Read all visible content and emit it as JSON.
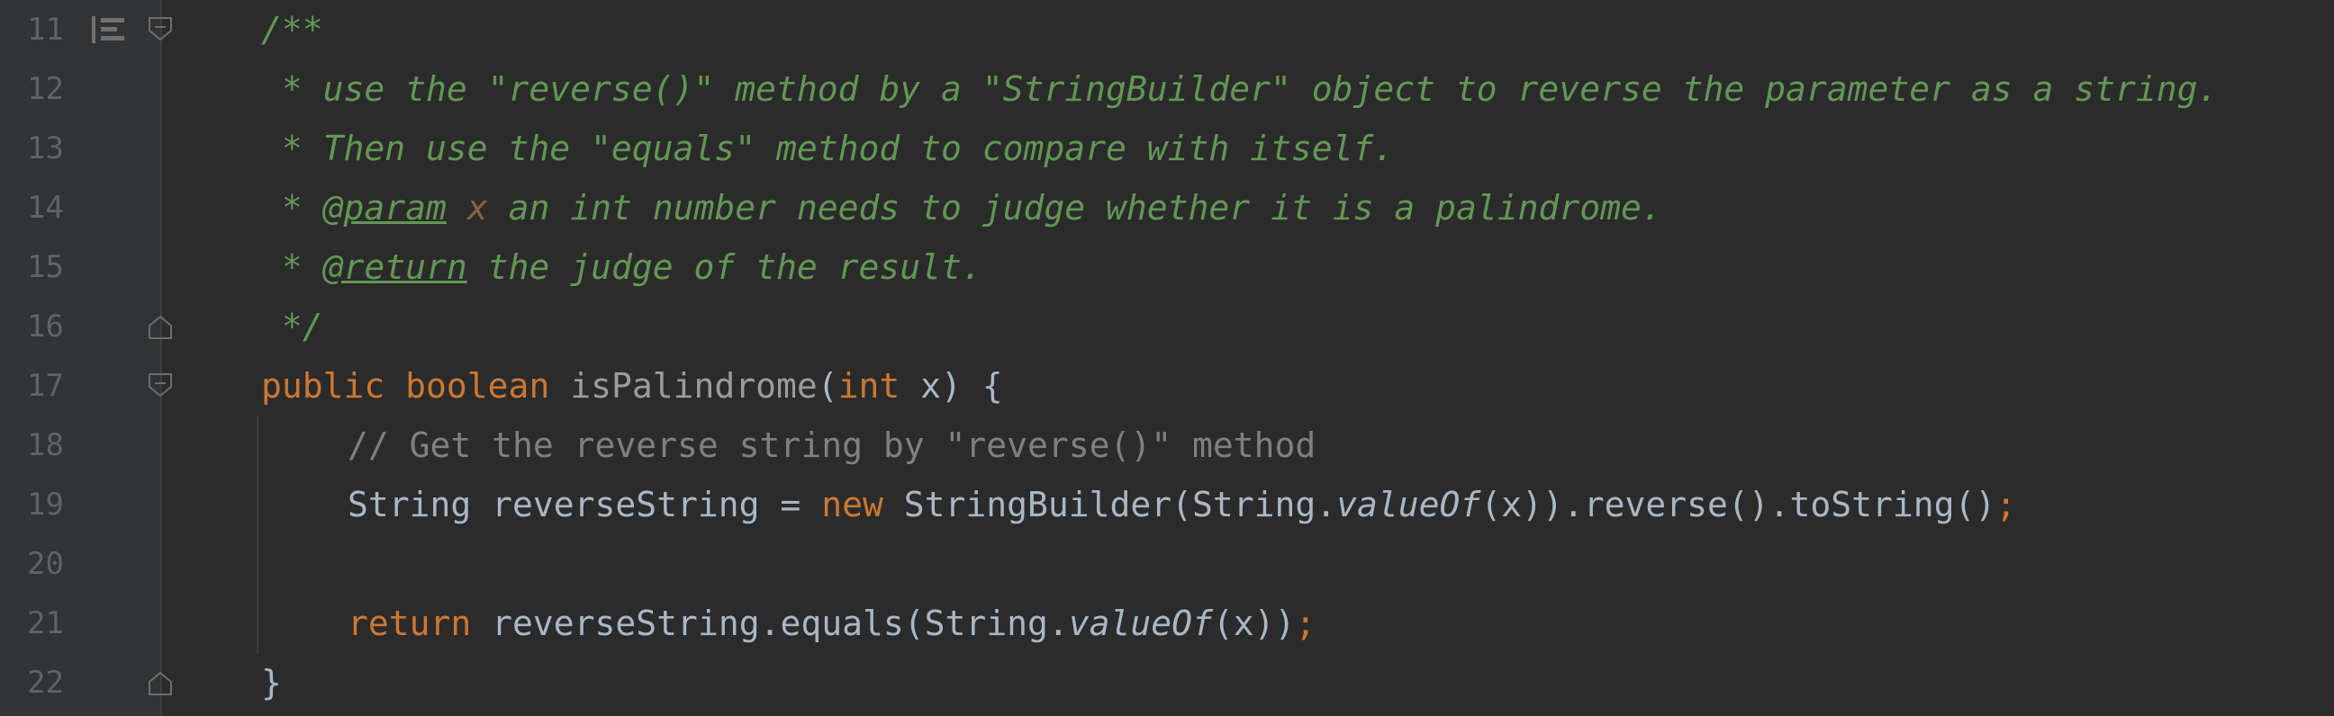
{
  "colors": {
    "background": "#2b2b2b",
    "gutter": "#313335",
    "line_number": "#606366",
    "doc_comment": "#629755",
    "keyword": "#cc7832",
    "plain": "#a9b7c6",
    "line_comment": "#808080",
    "doc_param_name": "#8a653b"
  },
  "icons": {
    "implements": "implemented-method-icon",
    "fold": "fold-marker-icon"
  },
  "lines": [
    {
      "num": "11",
      "t": [
        "/**"
      ]
    },
    {
      "num": "12",
      "t": [
        " * use the \"reverse()\" method by a \"StringBuilder\" object to reverse the parameter as a string."
      ]
    },
    {
      "num": "13",
      "t": [
        " * Then use the \"equals\" method to compare with itself."
      ]
    },
    {
      "num": "14",
      "t": [
        " * ",
        "@param",
        " ",
        "x",
        " an int number needs to judge whether it is a palindrome."
      ]
    },
    {
      "num": "15",
      "t": [
        " * ",
        "@return",
        " the judge of the result."
      ]
    },
    {
      "num": "16",
      "t": [
        " */"
      ]
    },
    {
      "num": "17",
      "t": [
        "public",
        " ",
        "boolean",
        " ",
        "isPalindrome",
        "(",
        "int",
        " x) {"
      ]
    },
    {
      "num": "18",
      "t": [
        "// Get the reverse string by \"reverse()\" method"
      ]
    },
    {
      "num": "19",
      "t": [
        "String reverseString = ",
        "new",
        " StringBuilder(String.",
        "valueOf",
        "(x)).reverse().toString()",
        ";"
      ]
    },
    {
      "num": "20",
      "t": []
    },
    {
      "num": "21",
      "t": [
        "return",
        " reverseString.equals(String.",
        "valueOf",
        "(x))",
        ";"
      ]
    },
    {
      "num": "22",
      "t": [
        "}"
      ]
    }
  ]
}
